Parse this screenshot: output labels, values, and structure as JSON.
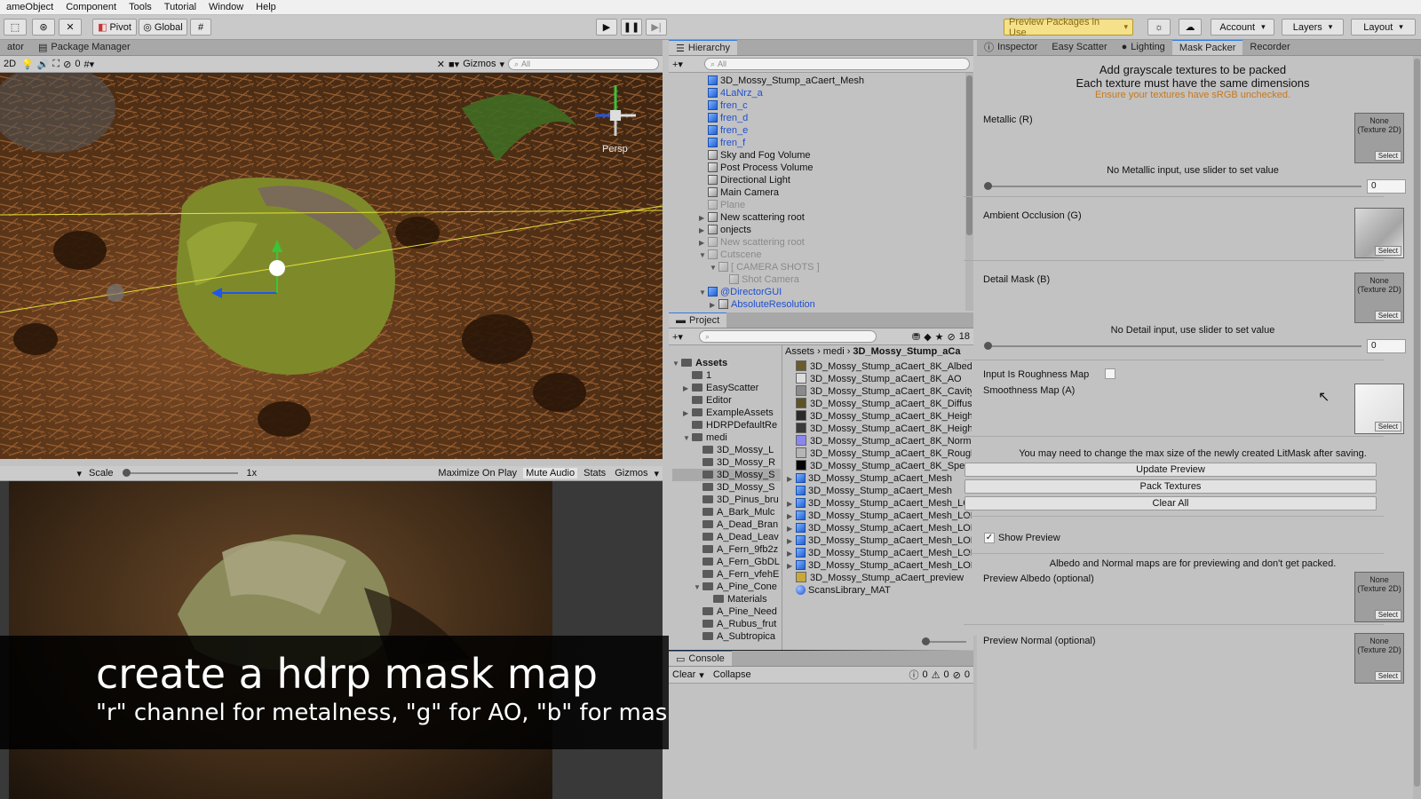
{
  "menu": [
    "ameObject",
    "Component",
    "Tools",
    "Tutorial",
    "Window",
    "Help"
  ],
  "toolbar": {
    "pivot": "Pivot",
    "global": "Global",
    "preview_packages": "Preview Packages in Use",
    "account": "Account",
    "layers": "Layers",
    "layout": "Layout"
  },
  "scene": {
    "tab_left": "ator",
    "tab_package_manager": "Package Manager",
    "mode_2d": "2D",
    "mute_count": "0",
    "gizmos": "Gizmos",
    "search_placeholder": "All",
    "persp": "Persp"
  },
  "game": {
    "scale_label": "Scale",
    "scale_value": "1x",
    "maximize": "Maximize On Play",
    "mute": "Mute Audio",
    "stats": "Stats",
    "gizmos": "Gizmos"
  },
  "caption": {
    "title": "create a hdrp mask map",
    "subtitle": "\"r\" channel for metalness, \"g\" for AO, \"b\" for mask & \"a\" for smoothness"
  },
  "hierarchy": {
    "tab": "Hierarchy",
    "search_placeholder": "All",
    "items": [
      {
        "label": "3D_Mossy_Stump_aCaert_Mesh",
        "style": "normal",
        "icon": "blue",
        "indent": 0,
        "arrow": ""
      },
      {
        "label": "4LaNrz_a",
        "style": "blue",
        "icon": "blue",
        "indent": 0,
        "arrow": ""
      },
      {
        "label": "fren_c",
        "style": "blue",
        "icon": "blue",
        "indent": 0,
        "arrow": ""
      },
      {
        "label": "fren_d",
        "style": "blue",
        "icon": "blue",
        "indent": 0,
        "arrow": ""
      },
      {
        "label": "fren_e",
        "style": "blue",
        "icon": "blue",
        "indent": 0,
        "arrow": ""
      },
      {
        "label": "fren_f",
        "style": "blue",
        "icon": "blue",
        "indent": 0,
        "arrow": ""
      },
      {
        "label": "Sky and Fog Volume",
        "style": "normal",
        "icon": "grey",
        "indent": 0,
        "arrow": ""
      },
      {
        "label": "Post Process Volume",
        "style": "normal",
        "icon": "grey",
        "indent": 0,
        "arrow": ""
      },
      {
        "label": "Directional Light",
        "style": "normal",
        "icon": "grey",
        "indent": 0,
        "arrow": ""
      },
      {
        "label": "Main Camera",
        "style": "normal",
        "icon": "grey",
        "indent": 0,
        "arrow": ""
      },
      {
        "label": "Plane",
        "style": "dim",
        "icon": "grey",
        "indent": 0,
        "arrow": ""
      },
      {
        "label": "New scattering root",
        "style": "normal",
        "icon": "grey",
        "indent": 0,
        "arrow": "▶"
      },
      {
        "label": "onjects",
        "style": "normal",
        "icon": "grey",
        "indent": 0,
        "arrow": "▶"
      },
      {
        "label": "New scattering root",
        "style": "dim",
        "icon": "grey",
        "indent": 0,
        "arrow": "▶"
      },
      {
        "label": "Cutscene",
        "style": "dim",
        "icon": "grey",
        "indent": 0,
        "arrow": "▼"
      },
      {
        "label": "[ CAMERA SHOTS ]",
        "style": "dim",
        "icon": "grey",
        "indent": 1,
        "arrow": "▼"
      },
      {
        "label": "Shot Camera",
        "style": "dim",
        "icon": "grey",
        "indent": 2,
        "arrow": ""
      },
      {
        "label": "@DirectorGUI",
        "style": "blue",
        "icon": "blue",
        "indent": 0,
        "arrow": "▼"
      },
      {
        "label": "AbsoluteResolution",
        "style": "blue",
        "icon": "grey",
        "indent": 1,
        "arrow": "▶"
      }
    ]
  },
  "project": {
    "tab": "Project",
    "count": "18",
    "breadcrumb": [
      "Assets",
      "medi",
      "3D_Mossy_Stump_aCa"
    ],
    "folders": [
      {
        "label": "Assets",
        "indent": 0,
        "arrow": "▼",
        "bold": true
      },
      {
        "label": "1",
        "indent": 1,
        "arrow": ""
      },
      {
        "label": "EasyScatter",
        "indent": 1,
        "arrow": "▶"
      },
      {
        "label": "Editor",
        "indent": 1,
        "arrow": ""
      },
      {
        "label": "ExampleAssets",
        "indent": 1,
        "arrow": "▶"
      },
      {
        "label": "HDRPDefaultRe",
        "indent": 1,
        "arrow": ""
      },
      {
        "label": "medi",
        "indent": 1,
        "arrow": "▼"
      },
      {
        "label": "3D_Mossy_L",
        "indent": 2,
        "arrow": ""
      },
      {
        "label": "3D_Mossy_R",
        "indent": 2,
        "arrow": ""
      },
      {
        "label": "3D_Mossy_S",
        "indent": 2,
        "arrow": "",
        "selected": true
      },
      {
        "label": "3D_Mossy_S",
        "indent": 2,
        "arrow": ""
      },
      {
        "label": "3D_Pinus_bru",
        "indent": 2,
        "arrow": ""
      },
      {
        "label": "A_Bark_Mulc",
        "indent": 2,
        "arrow": ""
      },
      {
        "label": "A_Dead_Bran",
        "indent": 2,
        "arrow": ""
      },
      {
        "label": "A_Dead_Leav",
        "indent": 2,
        "arrow": ""
      },
      {
        "label": "A_Fern_9fb2z",
        "indent": 2,
        "arrow": ""
      },
      {
        "label": "A_Fern_GbDL",
        "indent": 2,
        "arrow": ""
      },
      {
        "label": "A_Fern_vfehE",
        "indent": 2,
        "arrow": ""
      },
      {
        "label": "A_Pine_Cone",
        "indent": 2,
        "arrow": "▼"
      },
      {
        "label": "Materials",
        "indent": 3,
        "arrow": ""
      },
      {
        "label": "A_Pine_Need",
        "indent": 2,
        "arrow": ""
      },
      {
        "label": "A_Rubus_frut",
        "indent": 2,
        "arrow": ""
      },
      {
        "label": "A_Subtropica",
        "indent": 2,
        "arrow": ""
      }
    ],
    "assets": [
      {
        "label": "3D_Mossy_Stump_aCaert_8K_Albedo",
        "thumb": "#6b5a2a",
        "arrow": ""
      },
      {
        "label": "3D_Mossy_Stump_aCaert_8K_AO",
        "thumb": "#dcdcdc",
        "arrow": ""
      },
      {
        "label": "3D_Mossy_Stump_aCaert_8K_Cavity",
        "thumb": "#8a8a8a",
        "arrow": ""
      },
      {
        "label": "3D_Mossy_Stump_aCaert_8K_Diffuse",
        "thumb": "#5d5324",
        "arrow": ""
      },
      {
        "label": "3D_Mossy_Stump_aCaert_8K_Height",
        "thumb": "#2a2a2a",
        "arrow": ""
      },
      {
        "label": "3D_Mossy_Stump_aCaert_8K_Height",
        "thumb": "#3a3a3a",
        "arrow": ""
      },
      {
        "label": "3D_Mossy_Stump_aCaert_8K_Normal",
        "thumb": "#8a86f0",
        "arrow": ""
      },
      {
        "label": "3D_Mossy_Stump_aCaert_8K_Rough",
        "thumb": "#b5b5b5",
        "arrow": ""
      },
      {
        "label": "3D_Mossy_Stump_aCaert_8K_Specul",
        "thumb": "#050505",
        "arrow": ""
      },
      {
        "label": "3D_Mossy_Stump_aCaert_Mesh",
        "thumb": "mesh",
        "arrow": "▶"
      },
      {
        "label": "3D_Mossy_Stump_aCaert_Mesh",
        "thumb": "mesh",
        "arrow": ""
      },
      {
        "label": "3D_Mossy_Stump_aCaert_Mesh_LOD",
        "thumb": "mesh",
        "arrow": "▶"
      },
      {
        "label": "3D_Mossy_Stump_aCaert_Mesh_LOD",
        "thumb": "mesh",
        "arrow": "▶"
      },
      {
        "label": "3D_Mossy_Stump_aCaert_Mesh_LOD",
        "thumb": "mesh",
        "arrow": "▶"
      },
      {
        "label": "3D_Mossy_Stump_aCaert_Mesh_LOD",
        "thumb": "mesh",
        "arrow": "▶"
      },
      {
        "label": "3D_Mossy_Stump_aCaert_Mesh_LOD",
        "thumb": "mesh",
        "arrow": "▶"
      },
      {
        "label": "3D_Mossy_Stump_aCaert_Mesh_LOD",
        "thumb": "mesh",
        "arrow": "▶"
      },
      {
        "label": "3D_Mossy_Stump_aCaert_preview",
        "thumb": "#c9a83a",
        "arrow": ""
      },
      {
        "label": "ScansLibrary_MAT",
        "thumb": "mat",
        "arrow": ""
      }
    ]
  },
  "console": {
    "tab": "Console",
    "clear": "Clear",
    "collapse": "Collapse",
    "info": "0",
    "warn": "0",
    "error": "0"
  },
  "inspector": {
    "tabs": [
      "Inspector",
      "Easy Scatter",
      "Lighting",
      "Mask Packer",
      "Recorder"
    ],
    "header1": "Add grayscale textures to be packed",
    "header2": "Each texture must have the same dimensions",
    "header_warn": "Ensure your textures have sRGB unchecked.",
    "metallic": "Metallic (R)",
    "no_metallic": "No Metallic input, use slider to set value",
    "metallic_value": "0",
    "ao": "Ambient Occlusion (G)",
    "detail": "Detail Mask (B)",
    "no_detail": "No Detail input, use slider to set value",
    "detail_value": "0",
    "roughness_toggle": "Input Is Roughness Map",
    "smoothness": "Smoothness Map (A)",
    "none_tex": "None",
    "tex_type": "(Texture 2D)",
    "select": "Select",
    "note": "You may need to change the max size of the newly created LitMask after saving.",
    "update_preview": "Update Preview",
    "pack": "Pack Textures",
    "clear_all": "Clear All",
    "show_preview": "Show Preview",
    "albedo_note": "Albedo and Normal maps are for previewing and don't get packed.",
    "preview_albedo": "Preview Albedo (optional)",
    "preview_normal": "Preview Normal (optional)",
    "warn_color": "#c8781a",
    "accent": "#2f7de1"
  }
}
